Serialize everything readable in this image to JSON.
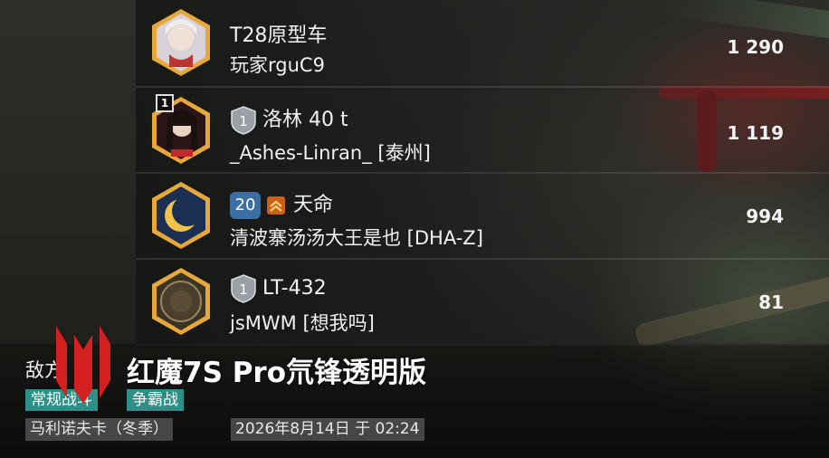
{
  "players": [
    {
      "vehicle": "T28原型车",
      "player": "玩家rguC9",
      "score": "1 290",
      "tier": null,
      "level": null,
      "rank_badge": null
    },
    {
      "vehicle": "洛林 40 t",
      "player": "_Ashes-Linran_ [泰州]",
      "score": "1 119",
      "tier": "1",
      "level": null,
      "rank_badge": "1"
    },
    {
      "vehicle": "天命",
      "player": "清波寨汤汤大王是也 [DHA-Z]",
      "score": "994",
      "tier": null,
      "level": "20",
      "rank_badge": null
    },
    {
      "vehicle": "LT-432",
      "player": "jsMWM [想我吗]",
      "score": "81",
      "tier": "1",
      "level": null,
      "rank_badge": null
    }
  ],
  "footer": {
    "title_visible": "敌方",
    "tags": [
      "常规战斗",
      "争霸战"
    ],
    "map": "马利诺夫卡（冬季）",
    "datetime": "2026年8月14日 于 02:24"
  },
  "watermark": "红魔7S Pro氘锋透明版",
  "colors": {
    "tag": "#2e8f86",
    "avatar_frame": "#e8a73a",
    "level_badge": "#3b6ea3",
    "brand_red": "#d42020"
  },
  "icons": [
    "tier-shield-icon",
    "rank-chevron-icon",
    "redmagic-logo-icon"
  ]
}
